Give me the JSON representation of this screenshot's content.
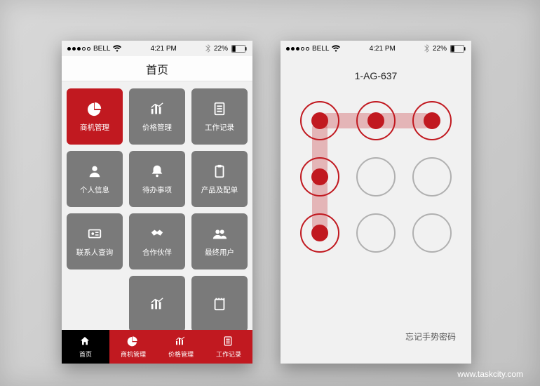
{
  "status": {
    "carrier": "BELL",
    "time": "4:21 PM",
    "battery_pct": "22%"
  },
  "phone1": {
    "title": "首页",
    "tiles": [
      {
        "label": "商机管理",
        "icon": "pie-chart-icon",
        "active": true
      },
      {
        "label": "价格管理",
        "icon": "bar-lines-icon"
      },
      {
        "label": "工作记录",
        "icon": "list-sheet-icon"
      },
      {
        "label": "个人信息",
        "icon": "person-icon"
      },
      {
        "label": "待办事项",
        "icon": "bell-icon"
      },
      {
        "label": "产品及配单",
        "icon": "clipboard-icon"
      },
      {
        "label": "联系人查询",
        "icon": "id-card-icon"
      },
      {
        "label": "合作伙伴",
        "icon": "handshake-icon"
      },
      {
        "label": "最终用户",
        "icon": "people-icon"
      },
      {
        "label": "",
        "icon": "bar-lines-icon"
      },
      {
        "label": "",
        "icon": "notepad-icon"
      }
    ],
    "tabs": [
      {
        "label": "首页",
        "icon": "home-icon",
        "style": "home"
      },
      {
        "label": "商机管理",
        "icon": "pie-chart-icon",
        "style": "red"
      },
      {
        "label": "价格管理",
        "icon": "bar-lines-icon",
        "style": "red"
      },
      {
        "label": "工作记录",
        "icon": "list-sheet-icon",
        "style": "red"
      }
    ]
  },
  "phone2": {
    "title": "1-AG-637",
    "pattern_active": [
      1,
      2,
      3,
      4,
      7
    ],
    "forgot": "忘记手势密码"
  },
  "footer": "www.taskcity.com"
}
